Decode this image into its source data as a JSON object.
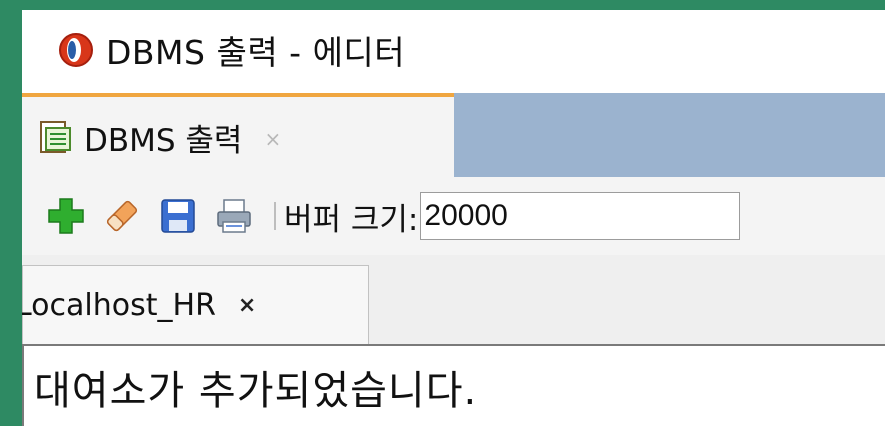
{
  "window": {
    "title": "DBMS 출력 - 에디터"
  },
  "tab": {
    "label": "DBMS 출력",
    "close": "×"
  },
  "toolbar": {
    "buttons": [
      {
        "name": "add-icon"
      },
      {
        "name": "eraser-icon"
      },
      {
        "name": "save-icon"
      },
      {
        "name": "print-icon"
      }
    ],
    "buffer_label": "버퍼 크기:",
    "buffer_value": "20000"
  },
  "connection_tab": {
    "label": "Localhost_HR",
    "close": "×"
  },
  "output": {
    "text": "대여소가 추가되었습니다."
  },
  "colors": {
    "frame": "#2e8a63",
    "tab_accent": "#f0a640",
    "tabstrip": "#9bb3cf",
    "add": "#2fae2f",
    "save": "#3b6fd1"
  }
}
